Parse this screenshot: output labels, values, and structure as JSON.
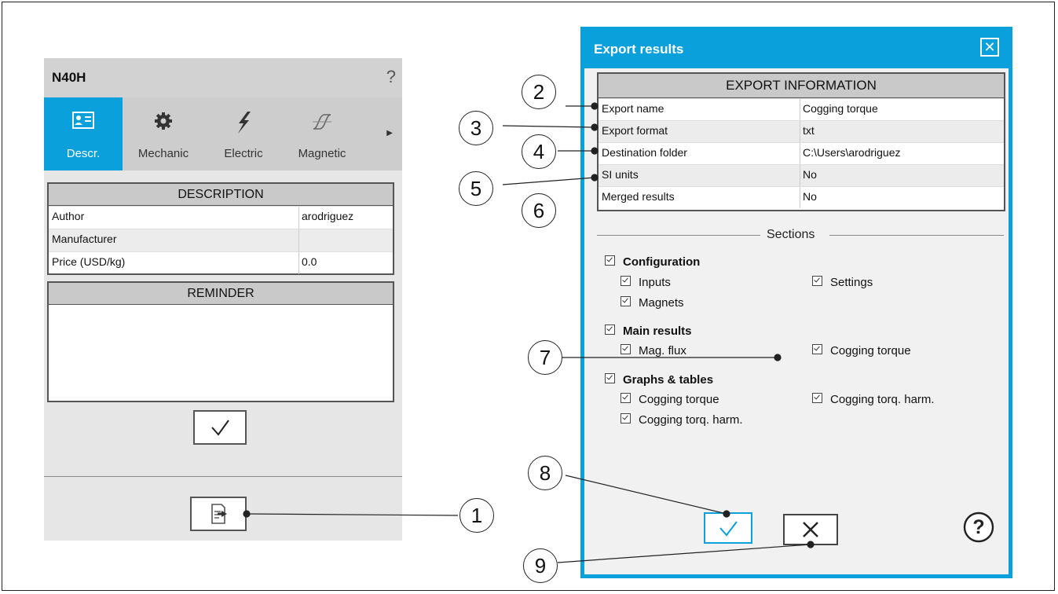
{
  "left_panel": {
    "title": "N40H",
    "help": "?",
    "tabs": [
      {
        "label": "Descr.",
        "icon": "id-card-icon",
        "active": true
      },
      {
        "label": "Mechanic",
        "icon": "gear-icon",
        "active": false
      },
      {
        "label": "Electric",
        "icon": "lightning-icon",
        "active": false
      },
      {
        "label": "Magnetic",
        "icon": "hysteresis-icon",
        "active": false
      }
    ],
    "description": {
      "header": "DESCRIPTION",
      "rows": [
        {
          "key": "Author",
          "value": "arodriguez"
        },
        {
          "key": "Manufacturer",
          "value": ""
        },
        {
          "key": "Price (USD/kg)",
          "value": "0.0"
        }
      ]
    },
    "reminder": {
      "header": "REMINDER",
      "text": ""
    }
  },
  "dialog": {
    "title": "Export results",
    "close": "✕",
    "info": {
      "header": "EXPORT INFORMATION",
      "rows": [
        {
          "key": "Export name",
          "value": "Cogging torque"
        },
        {
          "key": "Export format",
          "value": "txt"
        },
        {
          "key": "Destination folder",
          "value": "C:\\Users\\arodriguez"
        },
        {
          "key": "SI units",
          "value": "No"
        },
        {
          "key": "Merged results",
          "value": "No"
        }
      ]
    },
    "sections_label": "Sections",
    "sections": {
      "configuration": {
        "label": "Configuration",
        "items": [
          "Inputs",
          "Settings",
          "Magnets"
        ]
      },
      "main_results": {
        "label": "Main results",
        "items": [
          "Mag. flux",
          "Cogging torque"
        ]
      },
      "graphs": {
        "label": "Graphs & tables",
        "items": [
          "Cogging torque",
          "Cogging torq. harm.",
          "Cogging torq. harm."
        ]
      }
    },
    "help": "?"
  },
  "callouts": [
    "1",
    "2",
    "3",
    "4",
    "5",
    "6",
    "7",
    "8",
    "9"
  ],
  "colors": {
    "accent": "#0aa0dc"
  }
}
